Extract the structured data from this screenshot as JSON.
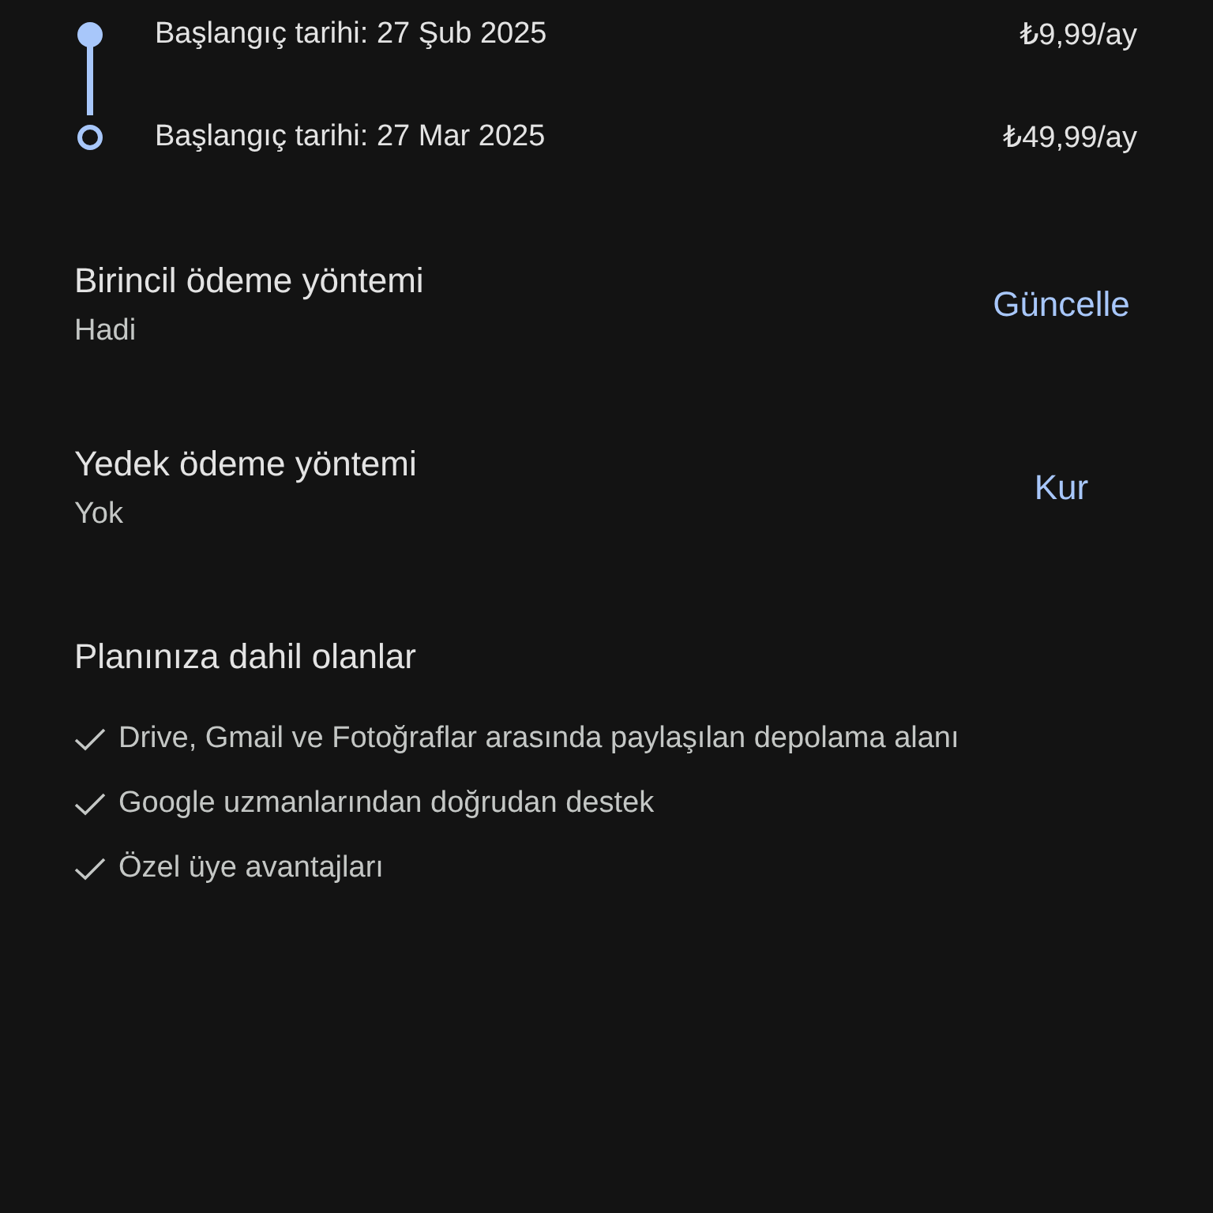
{
  "timeline": [
    {
      "kind": "filled",
      "label": "Başlangıç tarihi: 27 Şub 2025",
      "price": "₺9,99/ay"
    },
    {
      "kind": "ring",
      "label": "Başlangıç tarihi: 27 Mar 2025",
      "price": "₺49,99/ay"
    }
  ],
  "payment_methods": [
    {
      "title": "Birincil ödeme yöntemi",
      "value": "Hadi",
      "action": "Güncelle"
    },
    {
      "title": "Yedek ödeme yöntemi",
      "value": "Yok",
      "action": "Kur"
    }
  ],
  "plan": {
    "title": "Planınıza dahil olanlar",
    "features": [
      "Drive, Gmail ve Fotoğraflar arasında paylaşılan depolama alanı",
      "Google uzmanlarından doğrudan destek",
      "Özel üye avantajları"
    ]
  }
}
